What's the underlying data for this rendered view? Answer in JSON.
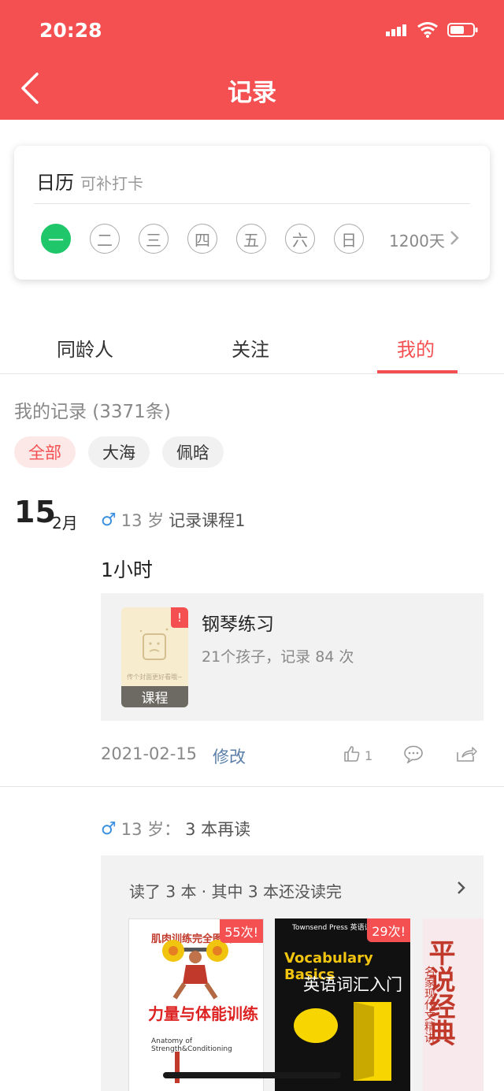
{
  "status": {
    "time": "20:28"
  },
  "header": {
    "title": "记录"
  },
  "calendar": {
    "title": "日历",
    "subtitle": "可补打卡",
    "days": [
      "一",
      "二",
      "三",
      "四",
      "五",
      "六",
      "日"
    ],
    "active_day": "一",
    "streak": "1200天"
  },
  "tabs": [
    {
      "label": "同龄人"
    },
    {
      "label": "关注"
    },
    {
      "label": "我的"
    }
  ],
  "records": {
    "title": "我的记录 (3371条)",
    "filters": [
      "全部",
      "大海",
      "佩晗"
    ]
  },
  "record1": {
    "day": "15",
    "month": "2月",
    "gender_icon": "male-icon",
    "age": "13 岁",
    "activity": "记录课程1",
    "duration": "1小时",
    "course": {
      "badge": "!",
      "cover_caption": "传个封面更好看哦~",
      "cover_label": "课程",
      "name": "钢琴练习",
      "stats": "21个孩子，记录 84 次"
    },
    "date": "2021-02-15",
    "edit": "修改",
    "likes": "1"
  },
  "record2": {
    "age": "13 岁：",
    "activity": "3 本再读",
    "summary": "读了 3 本 · 其中 3 本还没读完",
    "books": [
      {
        "title": "力量与体能训练",
        "top_title": "肌肉训练完全图解",
        "subtitle": "Anatomy of Strength&Conditioning",
        "count": "55次!"
      },
      {
        "title": "英语词汇入门",
        "publisher": "Townsend Press 英语词汇学",
        "subtitle": "Vocabulary Basics",
        "count": "29次!"
      },
      {
        "title": "平说经典",
        "subtitle": "名家现代文精讲"
      }
    ]
  },
  "colors": {
    "brand": "#f45052",
    "active_day": "#1fc76a",
    "link": "#5a7ea8"
  }
}
